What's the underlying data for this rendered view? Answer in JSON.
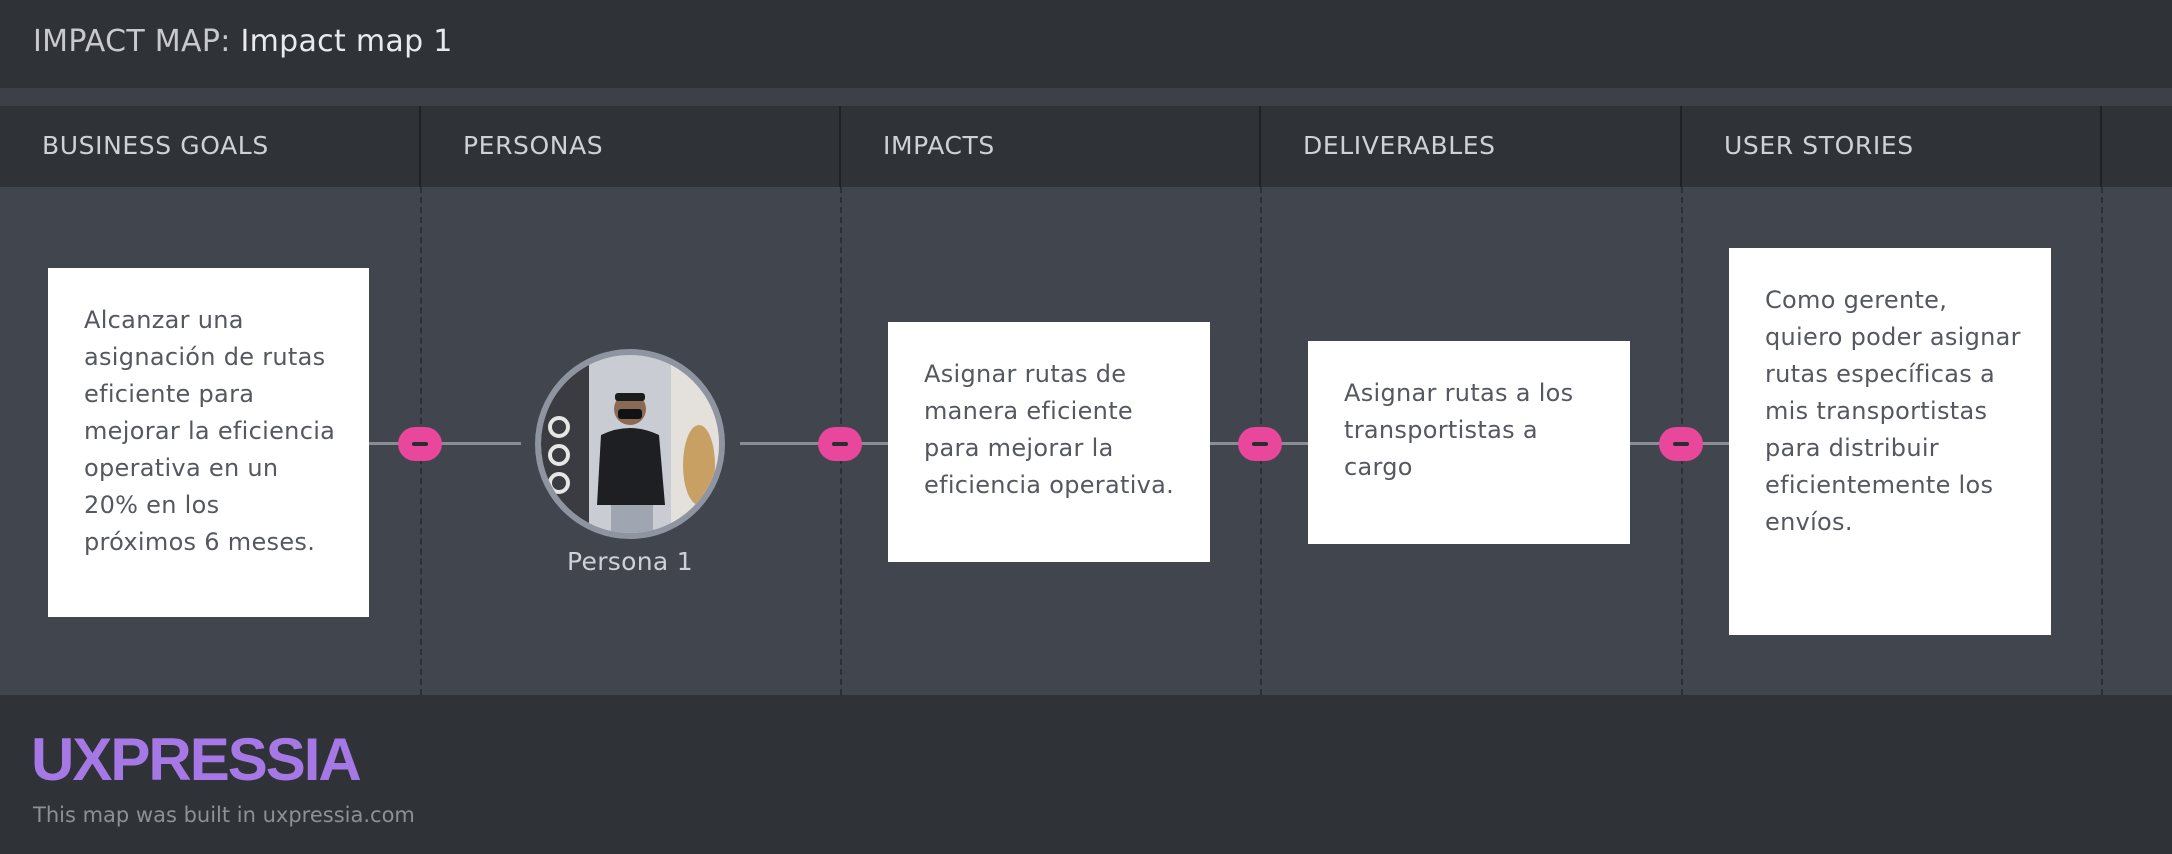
{
  "header": {
    "prefix": "IMPACT MAP:",
    "map_name": "Impact map 1"
  },
  "columns": [
    {
      "label": "BUSINESS GOALS"
    },
    {
      "label": "PERSONAS"
    },
    {
      "label": "IMPACTS"
    },
    {
      "label": "DELIVERABLES"
    },
    {
      "label": "USER STORIES"
    }
  ],
  "cards": {
    "business_goal": "Alcanzar una asignación de rutas eficiente para mejorar la eficiencia operativa en un 20% en los próximos 6 meses.",
    "impact": "Asignar rutas de manera eficiente para mejorar la eficiencia operativa.",
    "deliverable": "Asignar rutas a los transportistas a cargo",
    "user_story": "Como gerente, quiero poder asignar rutas específicas a mis transportistas para distribuir eficientemente los envíos."
  },
  "persona": {
    "name": "Persona 1"
  },
  "connectors": [
    {
      "icon": "collapse-minus-icon"
    },
    {
      "icon": "collapse-minus-icon"
    },
    {
      "icon": "collapse-minus-icon"
    },
    {
      "icon": "collapse-minus-icon"
    }
  ],
  "footer": {
    "logo": "UXPRESSIA",
    "credit": "This map was built in uxpressia.com"
  },
  "colors": {
    "accent": "#e8479b",
    "logo": "#a678e6",
    "background": "#2f3237",
    "body": "#41454d"
  }
}
